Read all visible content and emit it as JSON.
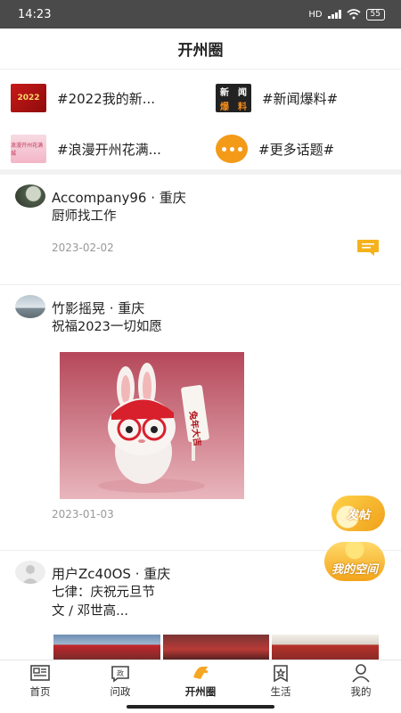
{
  "status_bar": {
    "time": "14:23",
    "network": "HD",
    "battery": "55"
  },
  "header": {
    "title": "开州圈"
  },
  "topics": [
    {
      "label": "#2022我的新...",
      "thumb_text": "2022"
    },
    {
      "label": "#新闻爆料#",
      "thumb_text": [
        "新",
        "闻",
        "爆",
        "料"
      ]
    },
    {
      "label": "#浪漫开州花满...",
      "thumb_text": "浪漫开州花满城"
    },
    {
      "label": "#更多话题#",
      "thumb_text": ""
    }
  ],
  "posts": [
    {
      "user": "Accompany96 · 重庆",
      "text": "厨师找工作",
      "date": "2023-02-02"
    },
    {
      "user": "竹影摇晃 · 重庆",
      "text": "祝福2023一切如愿",
      "date": "2023-01-03",
      "image_sign": "兔年大吉"
    },
    {
      "user": "用户Zc40OS · 重庆",
      "text_lines": [
        "七律：庆祝元旦节",
        "文 / 邓世高..."
      ]
    }
  ],
  "float_buttons": {
    "post": "发帖",
    "space": "我的空间"
  },
  "tabs": [
    {
      "label": "首页",
      "icon": "home-icon"
    },
    {
      "label": "问政",
      "icon": "inquiry-icon"
    },
    {
      "label": "开州圈",
      "icon": "kaizhou-circle-icon",
      "active": true
    },
    {
      "label": "生活",
      "icon": "life-icon"
    },
    {
      "label": "我的",
      "icon": "profile-icon"
    }
  ],
  "colors": {
    "accent": "#f5a623",
    "date_gray": "#999999",
    "comment_icon": "#f5b21b"
  }
}
